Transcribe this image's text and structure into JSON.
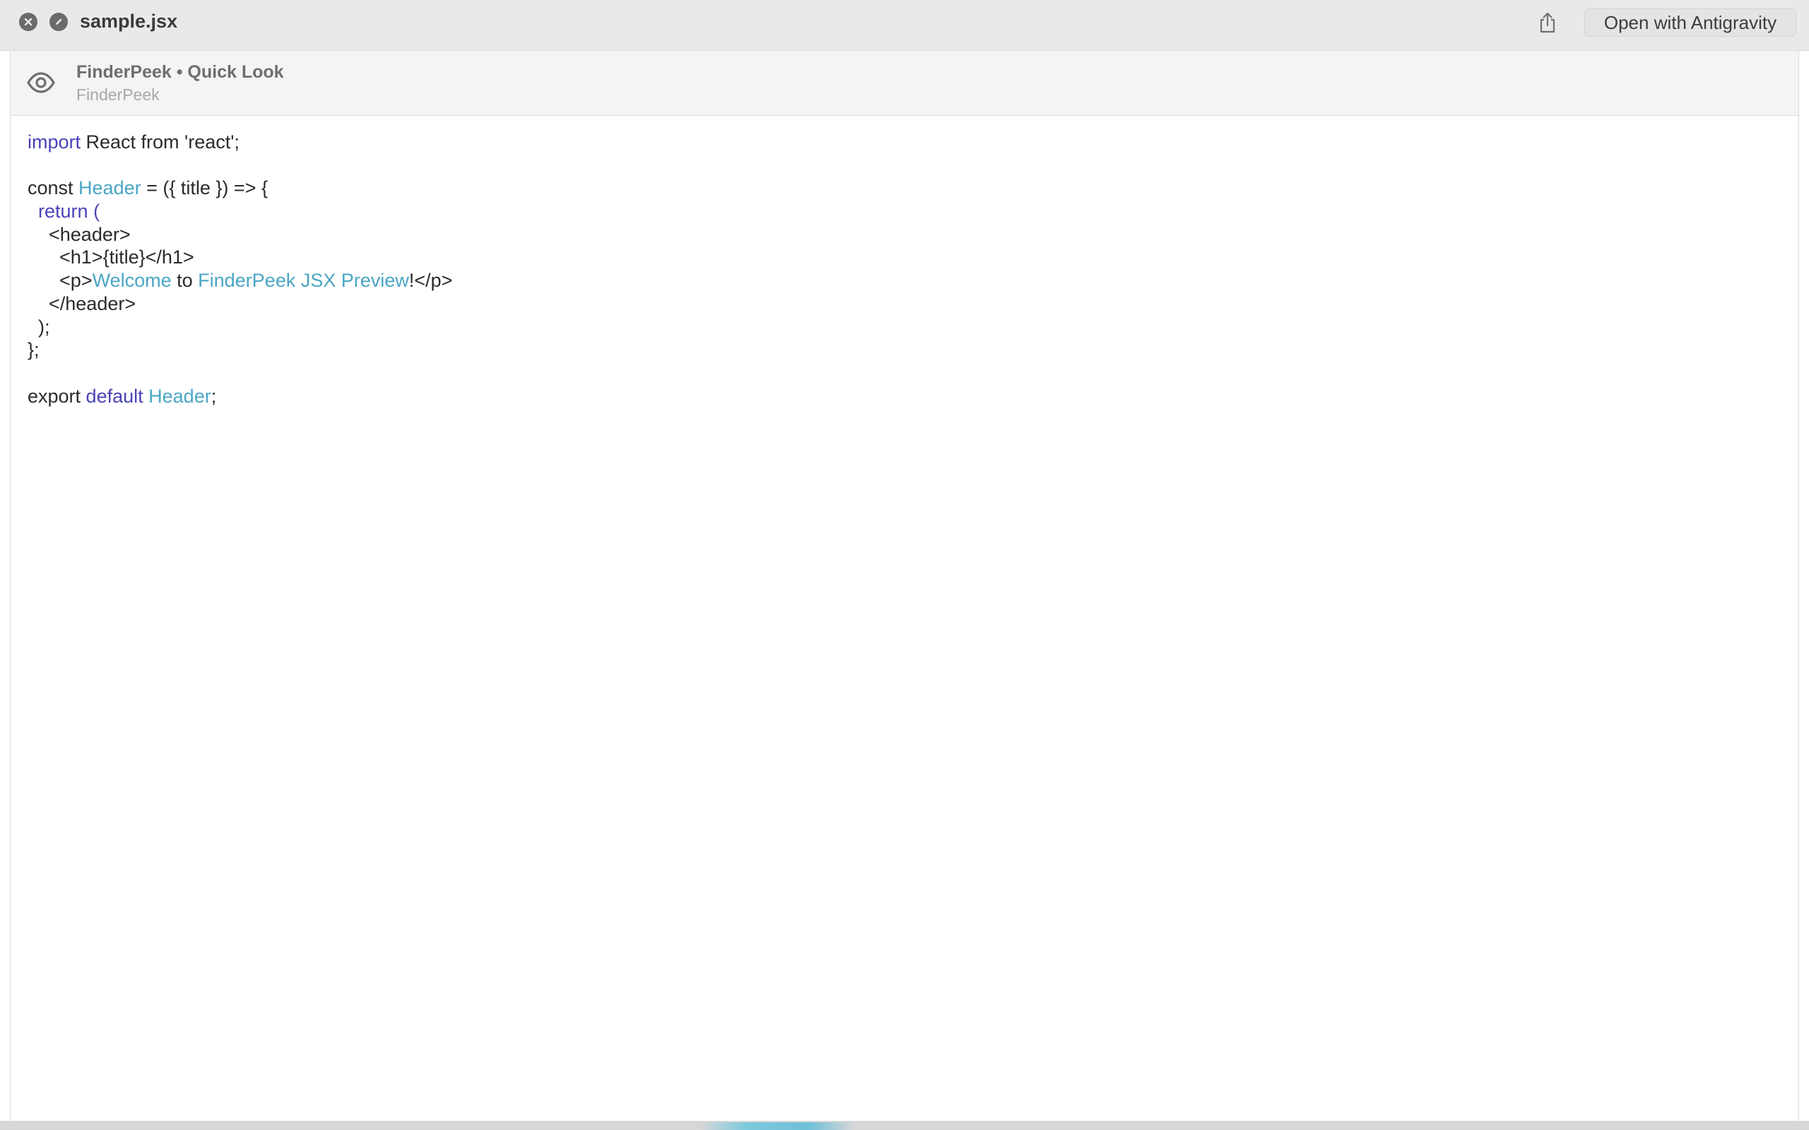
{
  "window": {
    "title": "sample.jsx",
    "open_with_label": "Open with Antigravity",
    "icons": {
      "close": "close-icon",
      "markup": "markup-icon",
      "share": "share-icon"
    }
  },
  "app_header": {
    "icon": "eye-icon",
    "title": "FinderPeek • Quick Look",
    "subtitle": "FinderPeek"
  },
  "colors": {
    "keyword": "#4a43b8",
    "type": "#4aa6c4",
    "text": "#2b2b2b"
  },
  "code": {
    "language": "jsx",
    "lines": [
      [
        {
          "t": "import",
          "k": "keyword"
        },
        {
          "t": " React from 'react';",
          "k": "plain"
        }
      ],
      [],
      [
        {
          "t": "const ",
          "k": "plain"
        },
        {
          "t": "Header",
          "k": "type"
        },
        {
          "t": " = ({ title }) => {",
          "k": "plain"
        }
      ],
      [
        {
          "t": "  ",
          "k": "plain"
        },
        {
          "t": "return",
          "k": "keyword"
        },
        {
          "t": " (",
          "k": "keyword"
        }
      ],
      [
        {
          "t": "    <header>",
          "k": "plain"
        }
      ],
      [
        {
          "t": "      <h1>{title}</h1>",
          "k": "plain"
        }
      ],
      [
        {
          "t": "      <p>",
          "k": "plain"
        },
        {
          "t": "Welcome",
          "k": "type"
        },
        {
          "t": " to ",
          "k": "plain"
        },
        {
          "t": "FinderPeek JSX Preview",
          "k": "type"
        },
        {
          "t": "!</p>",
          "k": "plain"
        }
      ],
      [
        {
          "t": "    </header>",
          "k": "plain"
        }
      ],
      [
        {
          "t": "  );",
          "k": "plain"
        }
      ],
      [
        {
          "t": "};",
          "k": "plain"
        }
      ],
      [],
      [
        {
          "t": "export ",
          "k": "plain"
        },
        {
          "t": "default",
          "k": "keyword"
        },
        {
          "t": " ",
          "k": "plain"
        },
        {
          "t": "Header",
          "k": "type"
        },
        {
          "t": ";",
          "k": "plain"
        }
      ]
    ]
  }
}
